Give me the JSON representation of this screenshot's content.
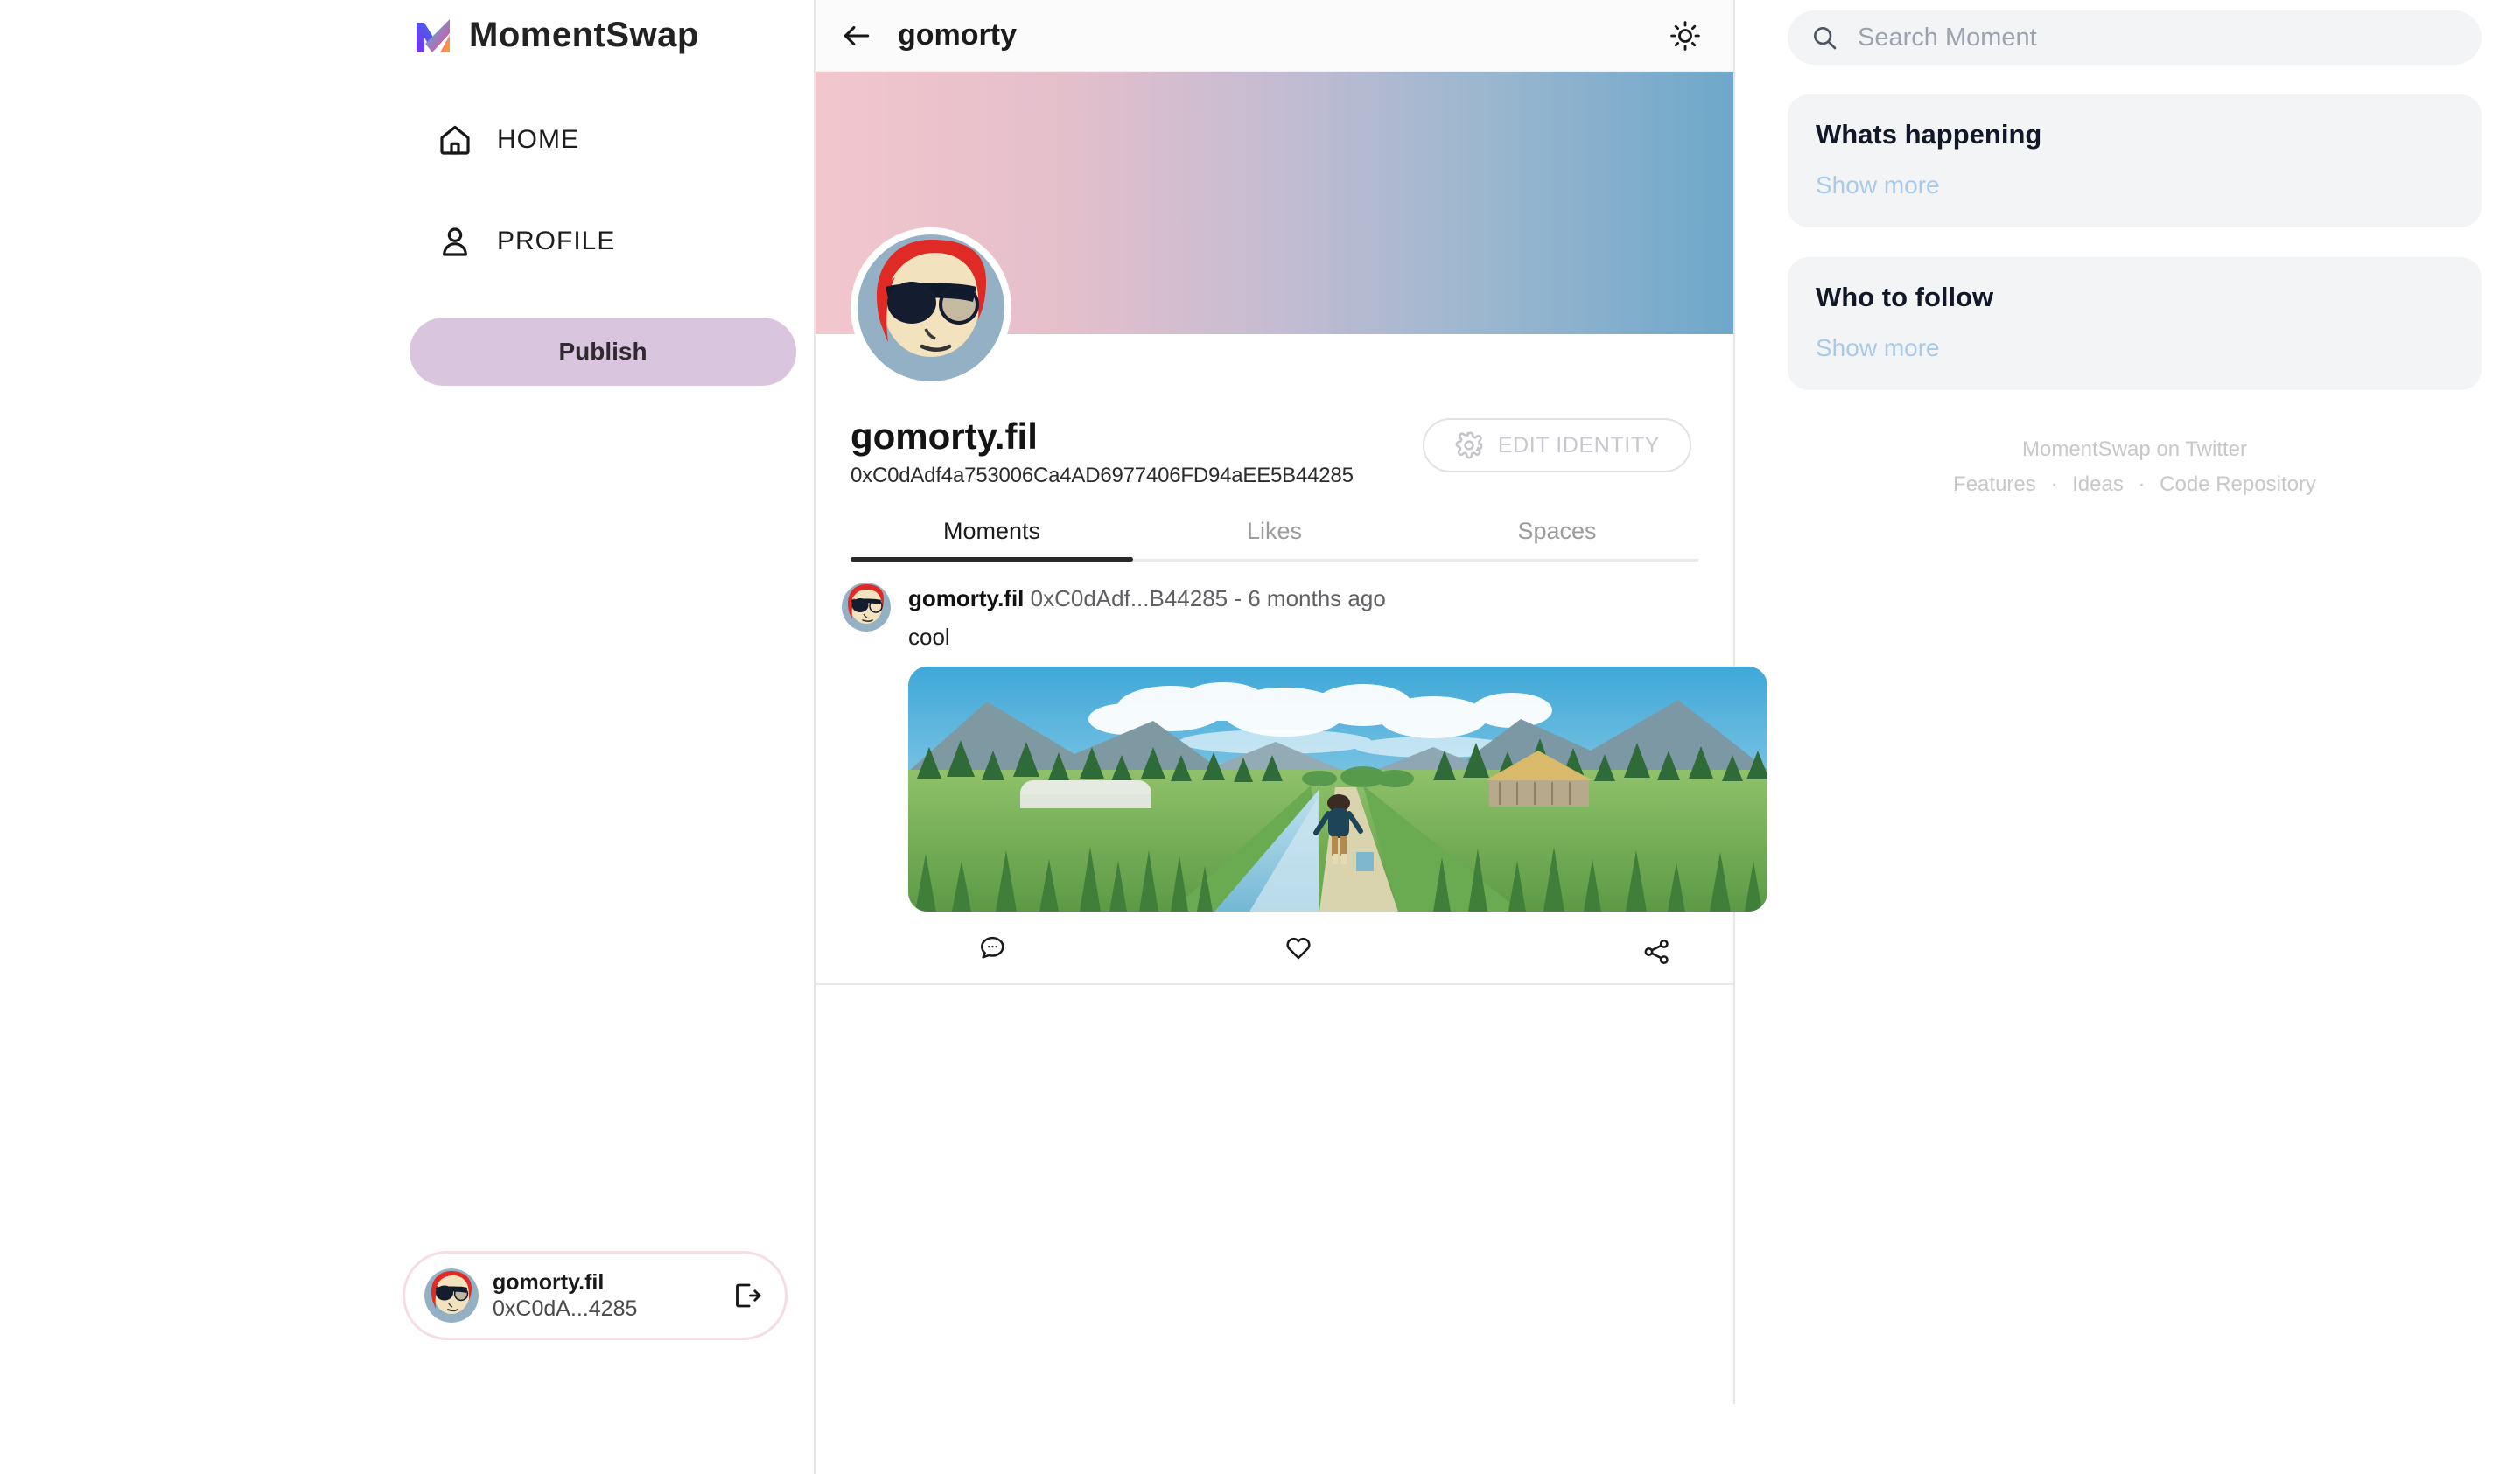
{
  "brand": {
    "name": "MomentSwap",
    "logo_icon": "momentswap-m-logo"
  },
  "sidebar": {
    "nav": [
      {
        "label": "HOME",
        "icon": "home-icon"
      },
      {
        "label": "PROFILE",
        "icon": "user-icon"
      }
    ],
    "publish_label": "Publish",
    "user_card": {
      "name": "gomorty.fil",
      "address": "0xC0dA...4285",
      "logout_icon": "logout-icon",
      "avatar_icon": "avatar-gomorty"
    }
  },
  "main": {
    "topbar": {
      "back_icon": "back-arrow-icon",
      "title": "gomorty",
      "theme_icon": "sun-icon"
    },
    "profile": {
      "display_name": "gomorty.fil",
      "address": "0xC0dAdf4a753006Ca4AD6977406FD94aEE5B44285",
      "edit_button_label": "EDIT IDENTITY",
      "edit_button_icon": "gear-icon",
      "banner_from": "#f3c6cd",
      "banner_to": "#6ea8ca"
    },
    "tabs": [
      {
        "label": "Moments",
        "active": true
      },
      {
        "label": "Likes",
        "active": false
      },
      {
        "label": "Spaces",
        "active": false
      }
    ],
    "post": {
      "author": "gomorty.fil",
      "sub": "0xC0dAdf...B44285 - 6 months ago",
      "text": "cool",
      "image_alt": "anime rice field landscape with boy",
      "actions": [
        {
          "name": "comment",
          "icon": "comment-icon"
        },
        {
          "name": "like",
          "icon": "heart-icon"
        },
        {
          "name": "share",
          "icon": "share-icon"
        }
      ]
    }
  },
  "right": {
    "search": {
      "placeholder": "Search Moment",
      "value": "",
      "icon": "search-icon"
    },
    "cards": [
      {
        "title": "Whats happening",
        "link": "Show more"
      },
      {
        "title": "Who to follow",
        "link": "Show more"
      }
    ],
    "footer": {
      "twitter": "MomentSwap on Twitter",
      "links": [
        "Features",
        "Ideas",
        "Code Repository"
      ],
      "separator": "·"
    }
  }
}
